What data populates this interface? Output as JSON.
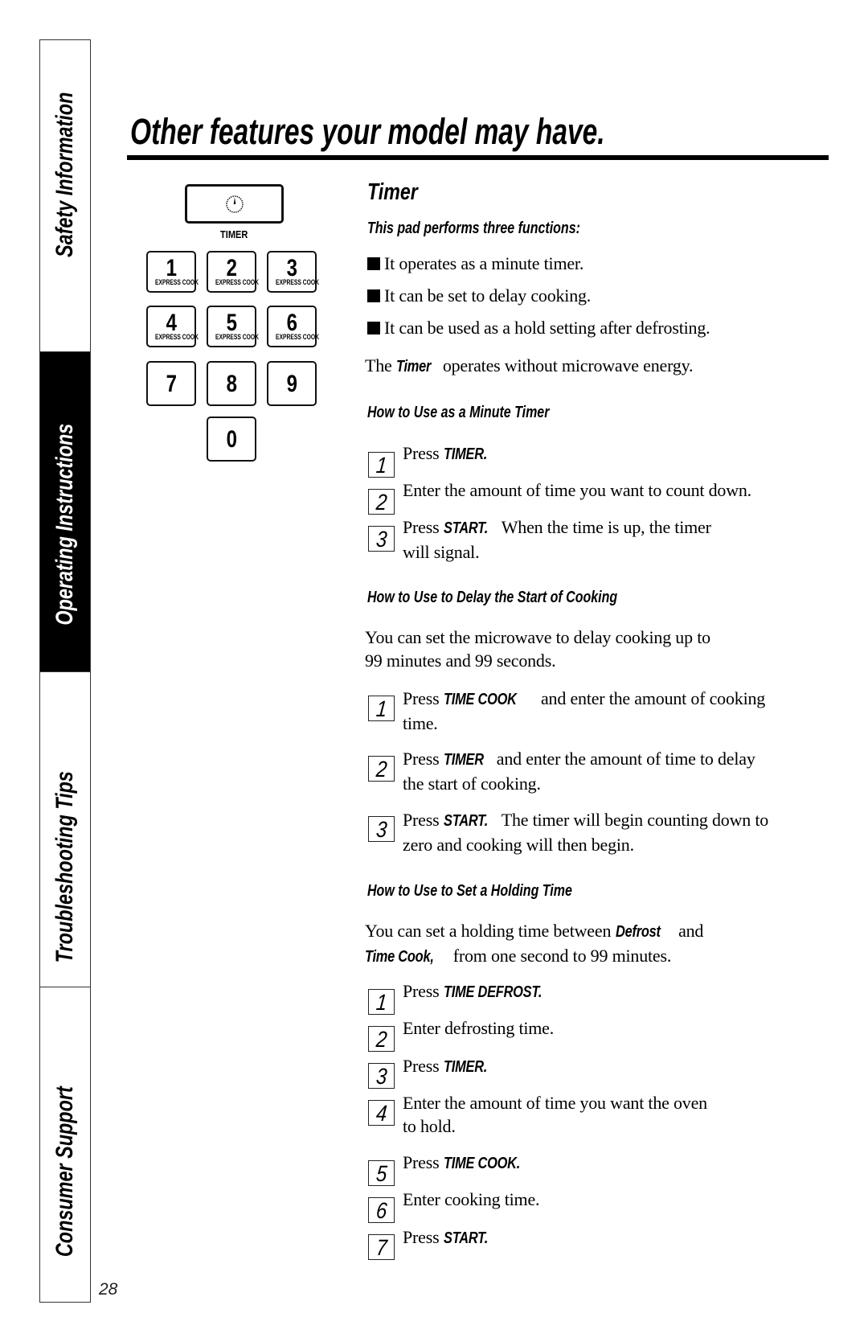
{
  "sidebar": {
    "tabs": [
      {
        "label": "Safety Information",
        "active": false
      },
      {
        "label": "Operating Instructions",
        "active": true
      },
      {
        "label": "Troubleshooting Tips",
        "active": false
      },
      {
        "label": "Consumer Support",
        "active": false
      }
    ],
    "page_number": "28"
  },
  "page": {
    "title": "Other features your model may have."
  },
  "keypad": {
    "timer_icon": "stopwatch-icon",
    "timer_label": "TIMER",
    "keys": [
      {
        "num": "1",
        "sub": "EXPRESS COOK"
      },
      {
        "num": "2",
        "sub": "EXPRESS COOK"
      },
      {
        "num": "3",
        "sub": "EXPRESS COOK"
      },
      {
        "num": "4",
        "sub": "EXPRESS COOK"
      },
      {
        "num": "5",
        "sub": "EXPRESS COOK"
      },
      {
        "num": "6",
        "sub": "EXPRESS COOK"
      },
      {
        "num": "7",
        "sub": ""
      },
      {
        "num": "8",
        "sub": ""
      },
      {
        "num": "9",
        "sub": ""
      },
      {
        "num": "0",
        "sub": ""
      }
    ]
  },
  "timer": {
    "heading": "Timer",
    "subheading": "This pad performs three functions:",
    "bullets": [
      "It operates as a minute timer.",
      "It can be set to delay cooking.",
      "It can be used as a hold setting after defrosting."
    ],
    "note": {
      "pre": "The ",
      "bold": "Timer",
      "post": " operates without microwave energy."
    }
  },
  "minute_timer": {
    "heading": "How to Use as a Minute Timer",
    "steps": [
      {
        "n": "1",
        "pre": "Press ",
        "bold": "TIMER.",
        "post": ""
      },
      {
        "n": "2",
        "pre": "Enter the amount of time you want to count down.",
        "bold": "",
        "post": ""
      },
      {
        "n": "3",
        "pre": "Press ",
        "bold": "START.",
        "post": " When the time is up, the timer",
        "line2": "will signal."
      }
    ]
  },
  "delay_start": {
    "heading": "How to Use to Delay the Start of Cooking",
    "intro_line1": "You can set the microwave to delay cooking up to",
    "intro_line2": "99 minutes and 99 seconds.",
    "steps": [
      {
        "n": "1",
        "pre": "Press ",
        "bold": "TIME COOK",
        "post": "  and enter the amount of cooking",
        "line2": "time."
      },
      {
        "n": "2",
        "pre": "Press ",
        "bold": "TIMER",
        "post": " and enter the amount of time to delay",
        "line2": "the start of cooking."
      },
      {
        "n": "3",
        "pre": "Press ",
        "bold": "START.",
        "post": " The timer will begin counting down to",
        "line2": "zero and cooking will then begin."
      }
    ]
  },
  "holding_time": {
    "heading": "How to Use to Set a Holding Time",
    "intro_line1": {
      "pre": "You can set a holding time between ",
      "bold": "Defrost",
      "post": "  and"
    },
    "intro_line2": {
      "bold": "Time Cook,",
      "post": " from one second to 99 minutes."
    },
    "steps": [
      {
        "n": "1",
        "pre": "Press ",
        "bold": "TIME DEFROST.",
        "post": ""
      },
      {
        "n": "2",
        "pre": "Enter defrosting time.",
        "bold": "",
        "post": ""
      },
      {
        "n": "3",
        "pre": "Press ",
        "bold": "TIMER.",
        "post": ""
      },
      {
        "n": "4",
        "pre": "Enter the amount of time you want the oven",
        "bold": "",
        "post": "",
        "line2": "to hold."
      },
      {
        "n": "5",
        "pre": "Press ",
        "bold": "TIME COOK.",
        "post": ""
      },
      {
        "n": "6",
        "pre": "Enter cooking time.",
        "bold": "",
        "post": ""
      },
      {
        "n": "7",
        "pre": "Press ",
        "bold": "START.",
        "post": ""
      }
    ]
  }
}
